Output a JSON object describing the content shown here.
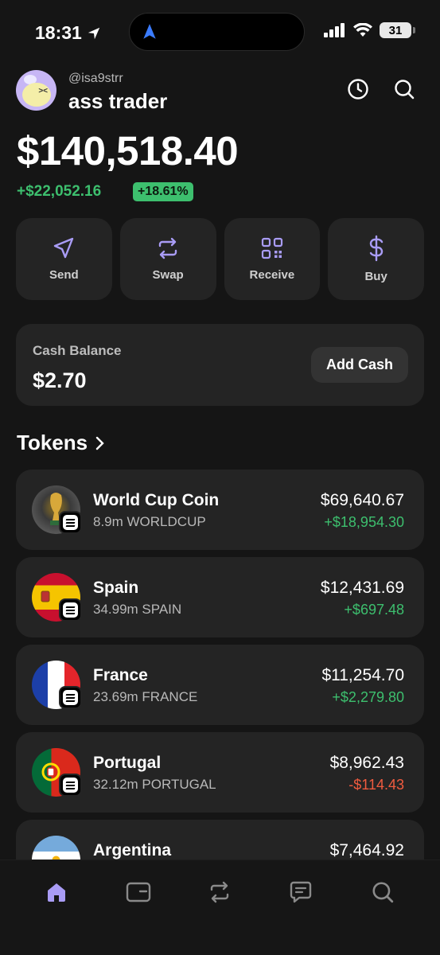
{
  "status_bar": {
    "time": "18:31",
    "battery": "31"
  },
  "profile": {
    "handle": "@isa9strr",
    "name": "ass trader"
  },
  "portfolio": {
    "total": "$140,518.40",
    "pnl": "+$22,052.16",
    "pnl_pct": "+18.61%"
  },
  "actions": [
    {
      "label": "Send",
      "icon": "send-icon"
    },
    {
      "label": "Swap",
      "icon": "swap-icon"
    },
    {
      "label": "Receive",
      "icon": "qr-code-icon"
    },
    {
      "label": "Buy",
      "icon": "dollar-icon"
    }
  ],
  "cash": {
    "title": "Cash Balance",
    "value": "$2.70",
    "button": "Add Cash"
  },
  "tokens_heading": "Tokens",
  "tokens": [
    {
      "name": "World Cup Coin",
      "amount": "8.9m WORLDCUP",
      "value": "$69,640.67",
      "change": "+$18,954.30",
      "direction": "up"
    },
    {
      "name": "Spain",
      "amount": "34.99m SPAIN",
      "value": "$12,431.69",
      "change": "+$697.48",
      "direction": "up"
    },
    {
      "name": "France",
      "amount": "23.69m FRANCE",
      "value": "$11,254.70",
      "change": "+$2,279.80",
      "direction": "up"
    },
    {
      "name": "Portugal",
      "amount": "32.12m PORTUGAL",
      "value": "$8,962.43",
      "change": "-$114.43",
      "direction": "down"
    },
    {
      "name": "Argentina",
      "amount": "",
      "value": "$7,464.92",
      "change": "",
      "direction": "up"
    }
  ],
  "tabbar": [
    "home-icon",
    "wallet-icon",
    "swap-icon",
    "chat-icon",
    "search-icon"
  ],
  "colors": {
    "accent": "#a99cf5",
    "positive": "#3dbf6e",
    "negative": "#f05b3f",
    "card": "#242424",
    "background": "#151515"
  }
}
